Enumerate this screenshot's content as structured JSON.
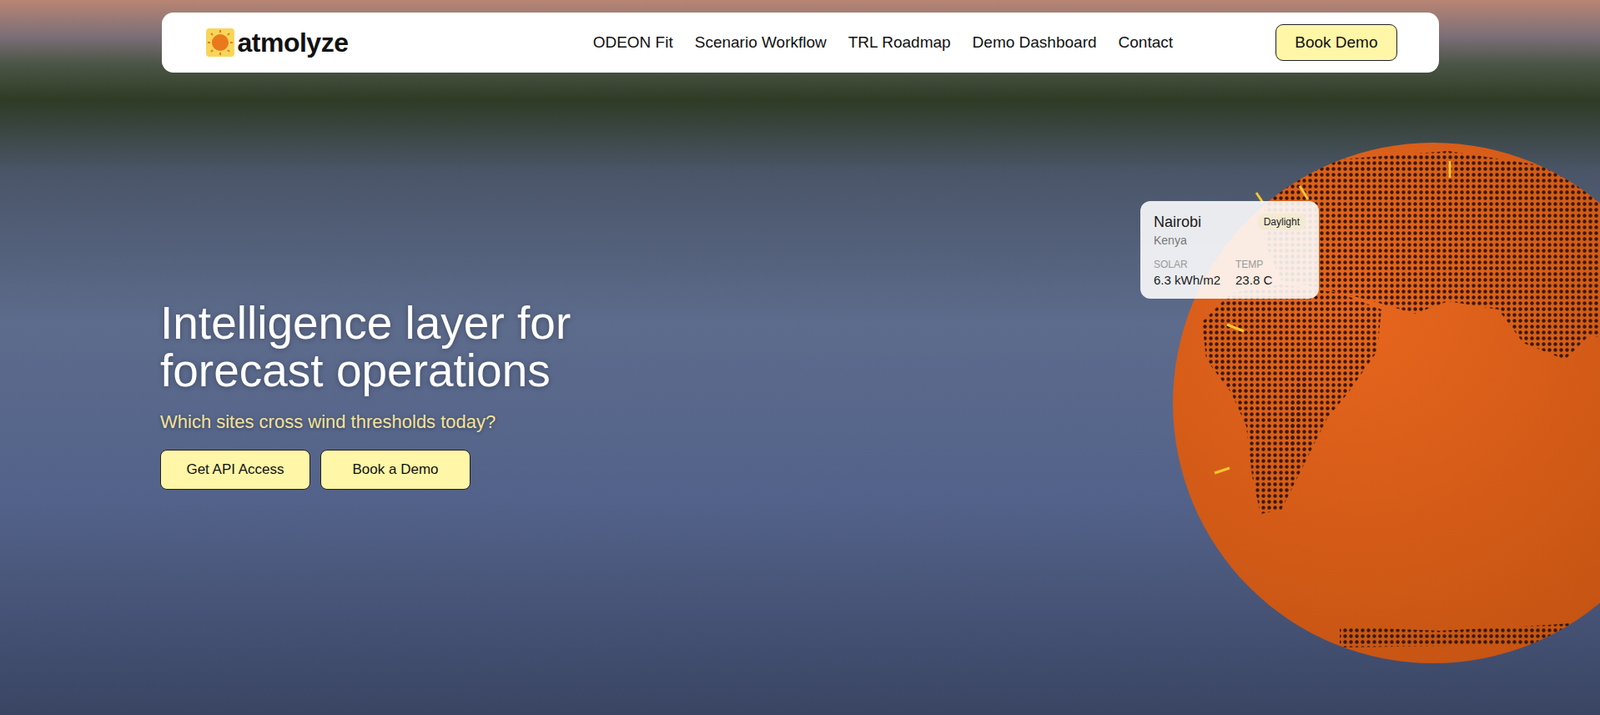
{
  "nav": {
    "logo": "atmolyze",
    "links": [
      {
        "label": "ODEON Fit"
      },
      {
        "label": "Scenario Workflow"
      },
      {
        "label": "TRL Roadmap"
      },
      {
        "label": "Demo Dashboard"
      },
      {
        "label": "Contact"
      }
    ],
    "cta": "Book Demo"
  },
  "hero": {
    "title_lines": [
      "Intelligence layer for",
      "forecast operations"
    ],
    "subtitle": "Which sites cross wind thresholds today?",
    "buttons": [
      "Get API Access",
      "Book a Demo"
    ]
  },
  "location_card": {
    "city": "Nairobi",
    "country": "Kenya",
    "badge": "Daylight",
    "stats": [
      {
        "label": "SOLAR",
        "value": "6.3 kWh/m2"
      },
      {
        "label": "TEMP",
        "value": "23.8 C"
      }
    ]
  }
}
